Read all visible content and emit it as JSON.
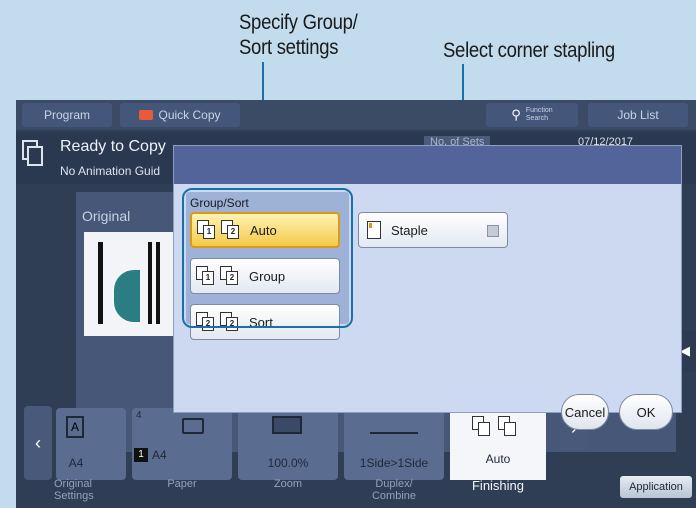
{
  "callouts": {
    "group_sort_line1": "Specify Group/",
    "group_sort_line2": "Sort settings",
    "staple": "Select corner stapling"
  },
  "topbar": {
    "program": "Program",
    "quick_copy": "Quick Copy",
    "function_search_line1": "Function",
    "function_search_line2": "Search",
    "job_list": "Job List"
  },
  "status": {
    "ready": "Ready to Copy",
    "no_animation": "No Animation Guid",
    "no_of_sets": "No. of Sets",
    "date": "07/12/2017"
  },
  "content": {
    "original_label": "Original"
  },
  "dialog": {
    "group_title": "Group/Sort",
    "auto": "Auto",
    "group": "Group",
    "sort": "Sort",
    "staple": "Staple",
    "cancel": "Cancel",
    "ok": "OK"
  },
  "tiles": {
    "original_size": "A4",
    "paper_size": "A4",
    "paper_tray": "1",
    "paper_count": "4",
    "zoom": "100.0%",
    "duplex": "1Side>1Side",
    "finishing": "Auto",
    "cap_original_line1": "Original",
    "cap_original_line2": "Settings",
    "cap_paper": "Paper",
    "cap_zoom": "Zoom",
    "cap_duplex_line1": "Duplex/",
    "cap_duplex_line2": "Combine",
    "cap_finishing": "Finishing",
    "application": "Application"
  },
  "colors": {
    "accent_line": "#1a70a8",
    "selected_button": "#f4c94a",
    "dialog_bg": "#cdd9f0"
  }
}
